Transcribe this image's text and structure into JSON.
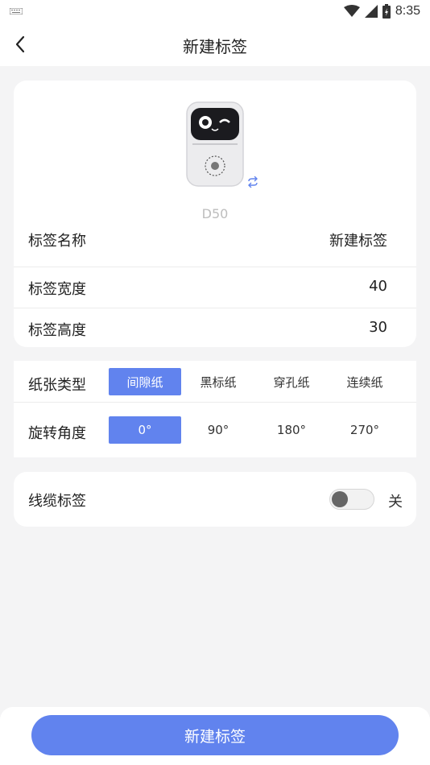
{
  "status_bar": {
    "time": "8:35",
    "icons": [
      "keyboard-icon",
      "wifi-icon",
      "signal-icon",
      "battery-icon"
    ]
  },
  "app_bar": {
    "title": "新建标签",
    "back_icon": "chevron-left-icon"
  },
  "device": {
    "model": "D50",
    "image": "printer-cat-face-image",
    "switch_icon": "refresh-icon"
  },
  "label_info": [
    {
      "label": "标签名称",
      "value": "新建标签"
    },
    {
      "label": "标签宽度",
      "value": "40"
    },
    {
      "label": "标签高度",
      "value": "30"
    }
  ],
  "paper_type": {
    "label": "纸张类型",
    "options": [
      "间隙纸",
      "黑标纸",
      "穿孔纸",
      "连续纸"
    ],
    "selected": "间隙纸"
  },
  "rotation": {
    "label": "旋转角度",
    "options": [
      "0°",
      "90°",
      "180°",
      "270°"
    ],
    "selected": "0°"
  },
  "cable_label": {
    "label": "线缆标签",
    "toggle_on": false,
    "state_text": "关"
  },
  "footer": {
    "button_label": "新建标签"
  },
  "colors": {
    "accent": "#6183ee",
    "background": "#f4f4f5",
    "card": "#ffffff"
  }
}
